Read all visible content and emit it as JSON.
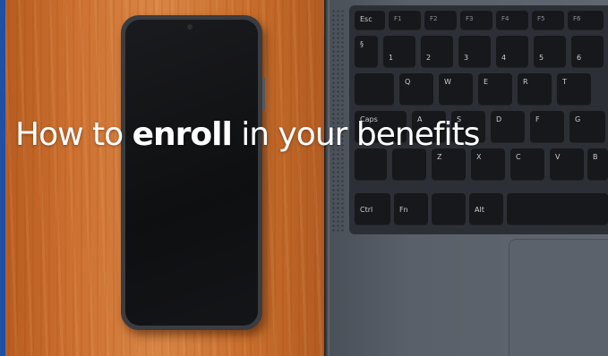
{
  "image": {
    "description_kind": "photo",
    "heading": {
      "before": "How to ",
      "emphasis": "enroll",
      "after": " in your benefits"
    }
  },
  "keyboard": {
    "keys": [
      "Esc",
      "F1",
      "F2",
      "F3",
      "F4",
      "F5",
      "F6",
      "§",
      "1",
      "2",
      "3",
      "4",
      "5",
      "6",
      "Q",
      "W",
      "E",
      "R",
      "T",
      "Caps",
      "A",
      "S",
      "D",
      "F",
      "G",
      "Z",
      "X",
      "C",
      "V",
      "B",
      "Ctrl",
      "Fn",
      "Alt"
    ]
  },
  "colors": {
    "wood": "#d88545",
    "phone": "#3a3c40",
    "laptop": "#5a6069",
    "text": "#ffffff"
  }
}
